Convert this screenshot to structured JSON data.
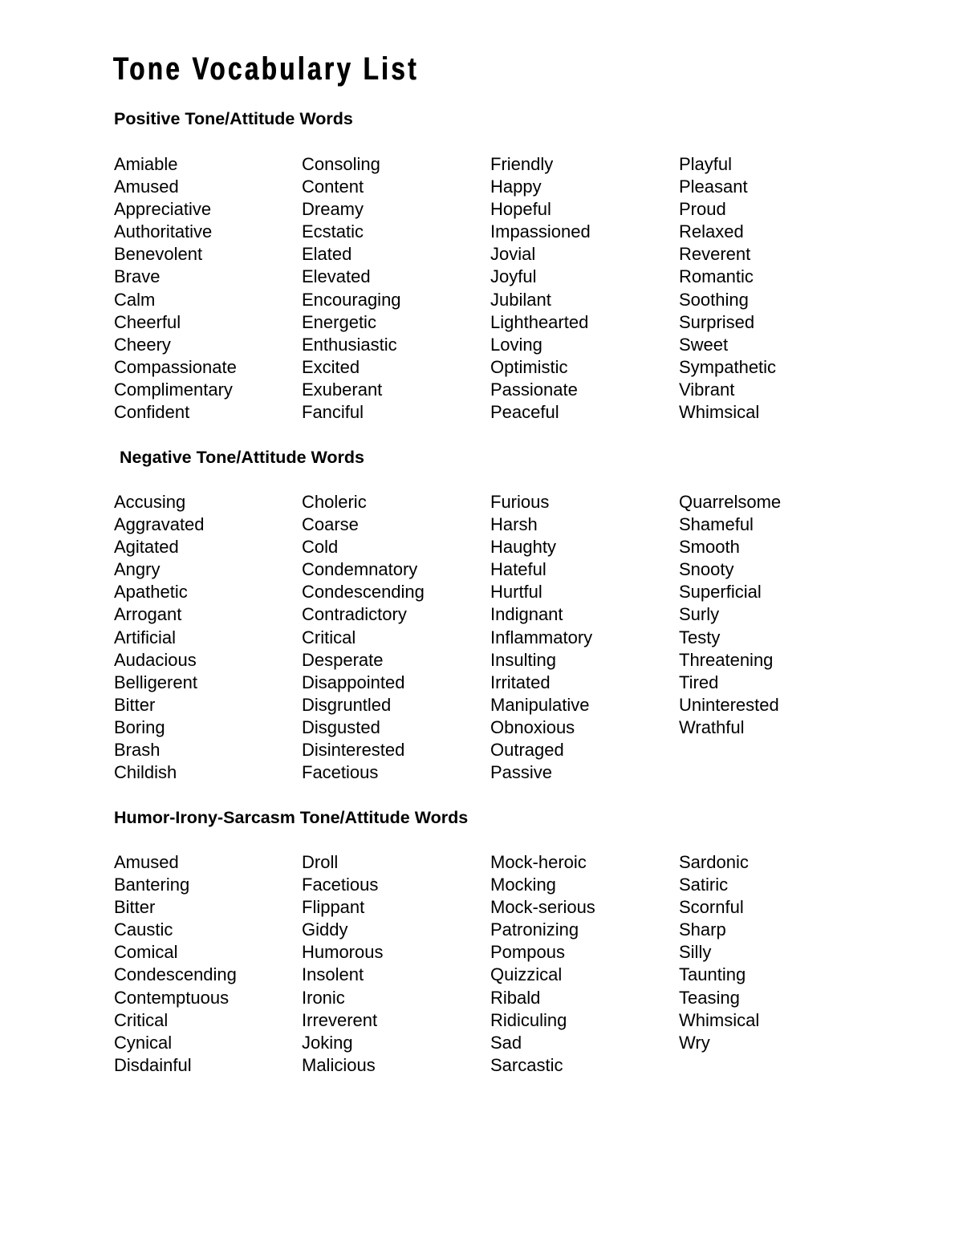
{
  "title": "Tone Vocabulary List",
  "sections": {
    "positive": {
      "heading": "Positive Tone/Attitude Words",
      "columns": [
        [
          "Amiable",
          "Amused",
          "Appreciative",
          "Authoritative",
          "Benevolent",
          "Brave",
          "Calm",
          "Cheerful",
          "Cheery",
          "Compassionate",
          "Complimentary",
          "Confident"
        ],
        [
          "Consoling",
          "Content",
          "Dreamy",
          "Ecstatic",
          "Elated",
          "Elevated",
          "Encouraging",
          "Energetic",
          "Enthusiastic",
          "Excited",
          "Exuberant",
          "Fanciful"
        ],
        [
          "Friendly",
          "Happy",
          "Hopeful",
          "Impassioned",
          "Jovial",
          "Joyful",
          "Jubilant",
          "Lighthearted",
          "Loving",
          "Optimistic",
          "Passionate",
          "Peaceful"
        ],
        [
          "Playful",
          "Pleasant",
          "Proud",
          "Relaxed",
          "Reverent",
          "Romantic",
          "Soothing",
          "Surprised",
          "Sweet",
          "Sympathetic",
          "Vibrant",
          "Whimsical"
        ]
      ]
    },
    "negative": {
      "heading": "Negative Tone/Attitude Words",
      "columns": [
        [
          "Accusing",
          "Aggravated",
          "Agitated",
          "Angry",
          "Apathetic",
          "Arrogant",
          "Artificial",
          "Audacious",
          "Belligerent",
          "Bitter",
          "Boring",
          "Brash",
          "Childish"
        ],
        [
          "Choleric",
          "Coarse",
          "Cold",
          "Condemnatory",
          "Condescending",
          "Contradictory",
          "Critical",
          "Desperate",
          "Disappointed",
          "Disgruntled",
          "Disgusted",
          "Disinterested",
          "Facetious"
        ],
        [
          "Furious",
          "Harsh",
          "Haughty",
          "Hateful",
          "Hurtful",
          "Indignant",
          "Inflammatory",
          "Insulting",
          "Irritated",
          "Manipulative",
          "Obnoxious",
          "Outraged",
          "Passive"
        ],
        [
          "Quarrelsome",
          "Shameful",
          "Smooth",
          "Snooty",
          "Superficial",
          "Surly",
          "Testy",
          "Threatening",
          "Tired",
          "Uninterested",
          "Wrathful"
        ]
      ]
    },
    "humor": {
      "heading": "Humor-Irony-Sarcasm Tone/Attitude Words",
      "columns": [
        [
          "Amused",
          "Bantering",
          "Bitter",
          "Caustic",
          "Comical",
          "Condescending",
          "Contemptuous",
          "Critical",
          "Cynical",
          "Disdainful"
        ],
        [
          "Droll",
          "Facetious",
          "Flippant",
          "Giddy",
          "Humorous",
          "Insolent",
          "Ironic",
          "Irreverent",
          "Joking",
          "Malicious"
        ],
        [
          "Mock-heroic",
          "Mocking",
          "Mock-serious",
          "Patronizing",
          "Pompous",
          "Quizzical",
          "Ribald",
          "Ridiculing",
          "Sad",
          "Sarcastic"
        ],
        [
          "Sardonic",
          "Satiric",
          "Scornful",
          "Sharp",
          "Silly",
          "Taunting",
          "Teasing",
          "Whimsical",
          "Wry"
        ]
      ]
    }
  }
}
